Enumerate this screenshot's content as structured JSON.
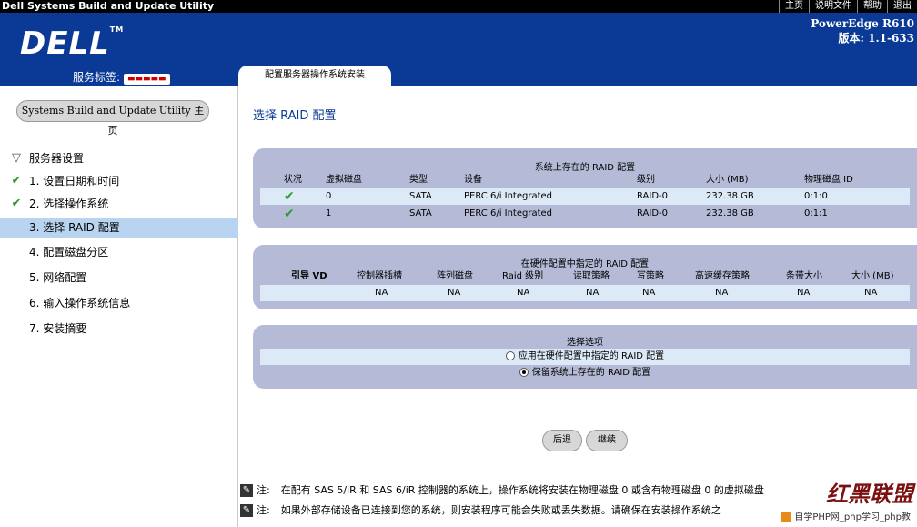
{
  "app": {
    "title": "Dell Systems Build and Update Utility",
    "top_links": [
      "主页",
      "说明文件",
      "帮助",
      "退出"
    ]
  },
  "header": {
    "logo": "DELL",
    "logo_tm": "TM",
    "service_tag_label": "服务标签:",
    "service_tag_value": "▬▬▬▬▬",
    "model": "PowerEdge R610",
    "version": "版本: 1.1-633"
  },
  "tab": {
    "label": "配置服务器操作系统安装"
  },
  "sidebar": {
    "home_button": "Systems Build and Update Utility 主页",
    "section": "服务器设置",
    "items": [
      {
        "label": "1. 设置日期和时间",
        "status": "done"
      },
      {
        "label": "2. 选择操作系统",
        "status": "done"
      },
      {
        "label": "3. 选择 RAID 配置",
        "status": "current"
      },
      {
        "label": "4. 配置磁盘分区",
        "status": "todo"
      },
      {
        "label": "5. 网络配置",
        "status": "todo"
      },
      {
        "label": "6. 输入操作系统信息",
        "status": "todo"
      },
      {
        "label": "7. 安装摘要",
        "status": "todo"
      }
    ]
  },
  "main": {
    "title": "选择 RAID 配置",
    "existing": {
      "title": "系统上存在的 RAID 配置",
      "headers": [
        "状况",
        "虚拟磁盘",
        "类型",
        "设备",
        "级别",
        "大小 (MB)",
        "物理磁盘 ID"
      ],
      "rows": [
        {
          "vd": "0",
          "type": "SATA",
          "device": "PERC 6/i Integrated",
          "level": "RAID-0",
          "size": "232.38 GB",
          "pd": "0:1:0"
        },
        {
          "vd": "1",
          "type": "SATA",
          "device": "PERC 6/i Integrated",
          "level": "RAID-0",
          "size": "232.38 GB",
          "pd": "0:1:1"
        }
      ]
    },
    "hardware": {
      "title": "在硬件配置中指定的 RAID 配置",
      "headers": [
        "引导 VD",
        "控制器插槽",
        "阵列磁盘",
        "Raid 级别",
        "读取策略",
        "写策略",
        "高速缓存策略",
        "条带大小",
        "大小 (MB)"
      ],
      "row": [
        "",
        "NA",
        "NA",
        "NA",
        "NA",
        "NA",
        "NA",
        "NA",
        "NA"
      ]
    },
    "options": {
      "title": "选择选项",
      "option1": "应用在硬件配置中指定的 RAID 配置",
      "option2": "保留系统上存在的 RAID 配置",
      "selected": 2
    },
    "back_button": "后退",
    "next_button": "继续",
    "note_label": "注:",
    "note1": "在配有 SAS 5/iR 和 SAS 6/iR 控制器的系统上，操作系统将安装在物理磁盘 0 或含有物理磁盘 0 的虚拟磁盘",
    "note2": "如果外部存储设备已连接到您的系统，则安装程序可能会失败或丢失数据。请确保在安装操作系统之"
  },
  "watermark": {
    "title": "红黑联盟",
    "sub": "自学PHP网_php学习_php教"
  }
}
